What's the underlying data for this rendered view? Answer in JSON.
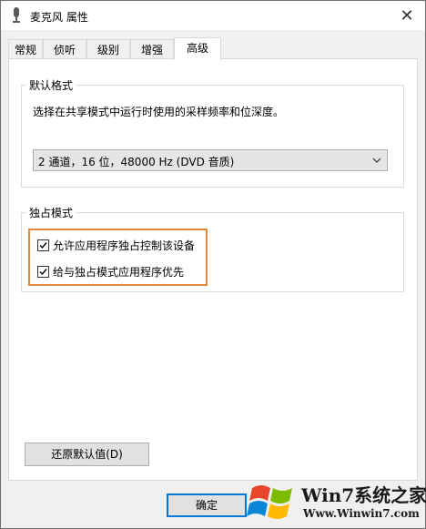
{
  "window": {
    "title": "麦克风 属性",
    "close_glyph": "✕"
  },
  "tabs": [
    {
      "label": "常规",
      "active": false
    },
    {
      "label": "侦听",
      "active": false
    },
    {
      "label": "级别",
      "active": false
    },
    {
      "label": "增强",
      "active": false
    },
    {
      "label": "高级",
      "active": true
    }
  ],
  "default_format": {
    "group_label": "默认格式",
    "description": "选择在共享模式中运行时使用的采样频率和位深度。",
    "selected_value": "2 通道，16 位，48000 Hz (DVD 音质)"
  },
  "exclusive_mode": {
    "group_label": "独占模式",
    "options": [
      {
        "label": "允许应用程序独占控制该设备",
        "checked": true
      },
      {
        "label": "给与独占模式应用程序优先",
        "checked": true
      }
    ],
    "highlight_color": "#e3873b"
  },
  "buttons": {
    "restore_defaults": "还原默认值(D)",
    "ok": "确定"
  },
  "watermark": {
    "line1": "Win7系统之家",
    "line2": "Www.Winwin7.com"
  },
  "colors": {
    "accent": "#0078d7",
    "highlight": "#e3873b"
  }
}
